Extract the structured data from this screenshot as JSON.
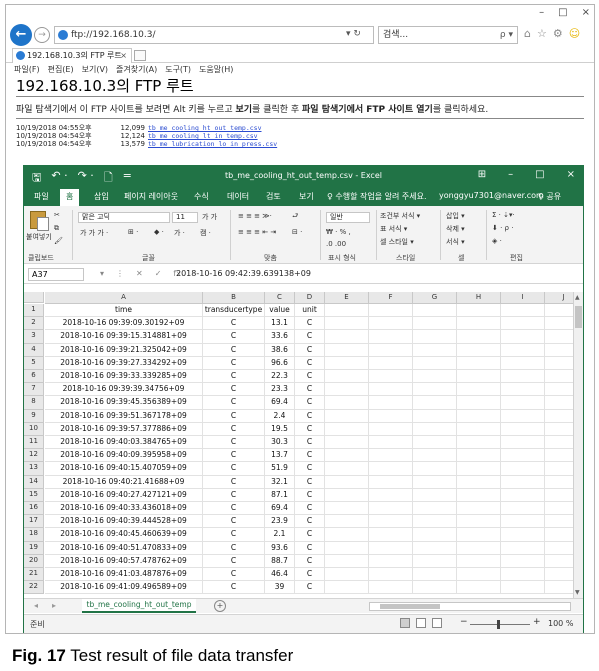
{
  "browser": {
    "window_controls": [
      "–",
      "□",
      "×"
    ],
    "address": "ftp://192.168.10.3/",
    "address_tools": "▾ ↻",
    "search_placeholder": "검색...",
    "search_icon": "ρ ▾",
    "tab_title": "192.168.10.3의 FTP 루트",
    "menu": [
      "파일(F)",
      "편집(E)",
      "보기(V)",
      "즐겨찾기(A)",
      "도구(T)",
      "도움말(H)"
    ]
  },
  "ftp": {
    "title": "192.168.10.3의 FTP 루트",
    "instruction": {
      "p1": "파일 탐색기에서 이 FTP 사이트를 보려면 Alt 키를 누르고 ",
      "b1": "보기",
      "p2": "를 클릭한 후 ",
      "b2": "파일 탐색기에서 FTP 사이트 열기",
      "p3": "를 클릭하세요."
    },
    "files": [
      {
        "date": "10/19/2018 04:55오후",
        "size": "12,099",
        "name": "tb_me_cooling_ht_out_temp.csv"
      },
      {
        "date": "10/19/2018 04:54오후",
        "size": "12,124",
        "name": "tb_me_cooling_lt_in_temp.csv"
      },
      {
        "date": "10/19/2018 04:54오후",
        "size": "13,579",
        "name": "tb_me_lubrication_lo_in_press.csv"
      }
    ]
  },
  "excel": {
    "qat": [
      "🖫",
      "↶ ·",
      "↷ ·",
      "🗋",
      "="
    ],
    "title": "tb_me_cooling_ht_out_temp.csv - Excel",
    "win_buttons": [
      "⊞",
      "–",
      "□",
      "×"
    ],
    "tabs": [
      "파일",
      "홈",
      "삽입",
      "페이지 레이아웃",
      "수식",
      "데이터",
      "검토",
      "보기"
    ],
    "tell_me": "♀ 수행할 작업을 알려 주세요.",
    "user": "yonggyu7301@naver.com",
    "share": "♀ 공유",
    "ribbon": {
      "paste": "붙여넣기",
      "font_name": "맑은 고딕",
      "font_size": "11",
      "number_format": "일반",
      "cond_format": "조건부 서식 ▾",
      "table_format": "표 서식 ▾",
      "cell_style": "셀 스타일 ▾",
      "insert": "삽입 ▾",
      "delete": "삭제 ▾",
      "format": "서식 ▾",
      "groups": [
        "클립보드",
        "글꼴",
        "맞춤",
        "표시 형식",
        "스타일",
        "셀",
        "편집"
      ]
    },
    "namebox": "A37",
    "formula_buttons": [
      "▾",
      "⋮",
      "✕",
      "✓",
      "fx"
    ],
    "formula": "2018-10-16 09:42:39.639138+09",
    "columns": [
      "A",
      "B",
      "C",
      "D",
      "E",
      "F",
      "G",
      "H",
      "I",
      "J"
    ],
    "headers": [
      "time",
      "transducertype",
      "value",
      "unit"
    ],
    "rows": [
      [
        "2018-10-16 09:39:09.30192+09",
        "C",
        "13.1",
        "C"
      ],
      [
        "2018-10-16 09:39:15.314881+09",
        "C",
        "33.6",
        "C"
      ],
      [
        "2018-10-16 09:39:21.325042+09",
        "C",
        "38.6",
        "C"
      ],
      [
        "2018-10-16 09:39:27.334292+09",
        "C",
        "96.6",
        "C"
      ],
      [
        "2018-10-16 09:39:33.339285+09",
        "C",
        "22.3",
        "C"
      ],
      [
        "2018-10-16 09:39:39.34756+09",
        "C",
        "23.3",
        "C"
      ],
      [
        "2018-10-16 09:39:45.356389+09",
        "C",
        "69.4",
        "C"
      ],
      [
        "2018-10-16 09:39:51.367178+09",
        "C",
        "2.4",
        "C"
      ],
      [
        "2018-10-16 09:39:57.377886+09",
        "C",
        "19.5",
        "C"
      ],
      [
        "2018-10-16 09:40:03.384765+09",
        "C",
        "30.3",
        "C"
      ],
      [
        "2018-10-16 09:40:09.395958+09",
        "C",
        "13.7",
        "C"
      ],
      [
        "2018-10-16 09:40:15.407059+09",
        "C",
        "51.9",
        "C"
      ],
      [
        "2018-10-16 09:40:21.41688+09",
        "C",
        "32.1",
        "C"
      ],
      [
        "2018-10-16 09:40:27.427121+09",
        "C",
        "87.1",
        "C"
      ],
      [
        "2018-10-16 09:40:33.436018+09",
        "C",
        "69.4",
        "C"
      ],
      [
        "2018-10-16 09:40:39.444528+09",
        "C",
        "23.9",
        "C"
      ],
      [
        "2018-10-16 09:40:45.460639+09",
        "C",
        "2.1",
        "C"
      ],
      [
        "2018-10-16 09:40:51.470833+09",
        "C",
        "93.6",
        "C"
      ],
      [
        "2018-10-16 09:40:57.478762+09",
        "C",
        "88.7",
        "C"
      ],
      [
        "2018-10-16 09:41:03.487876+09",
        "C",
        "46.4",
        "C"
      ],
      [
        "2018-10-16 09:41:09.496589+09",
        "C",
        "39",
        "C"
      ]
    ],
    "sheet_tab": "tb_me_cooling_ht_out_temp",
    "sheet_navs": [
      "◂",
      "▸"
    ],
    "status": "준비",
    "zoom": "100 %"
  },
  "caption": {
    "label": "Fig. 17",
    "text": " Test result of file data transfer"
  }
}
